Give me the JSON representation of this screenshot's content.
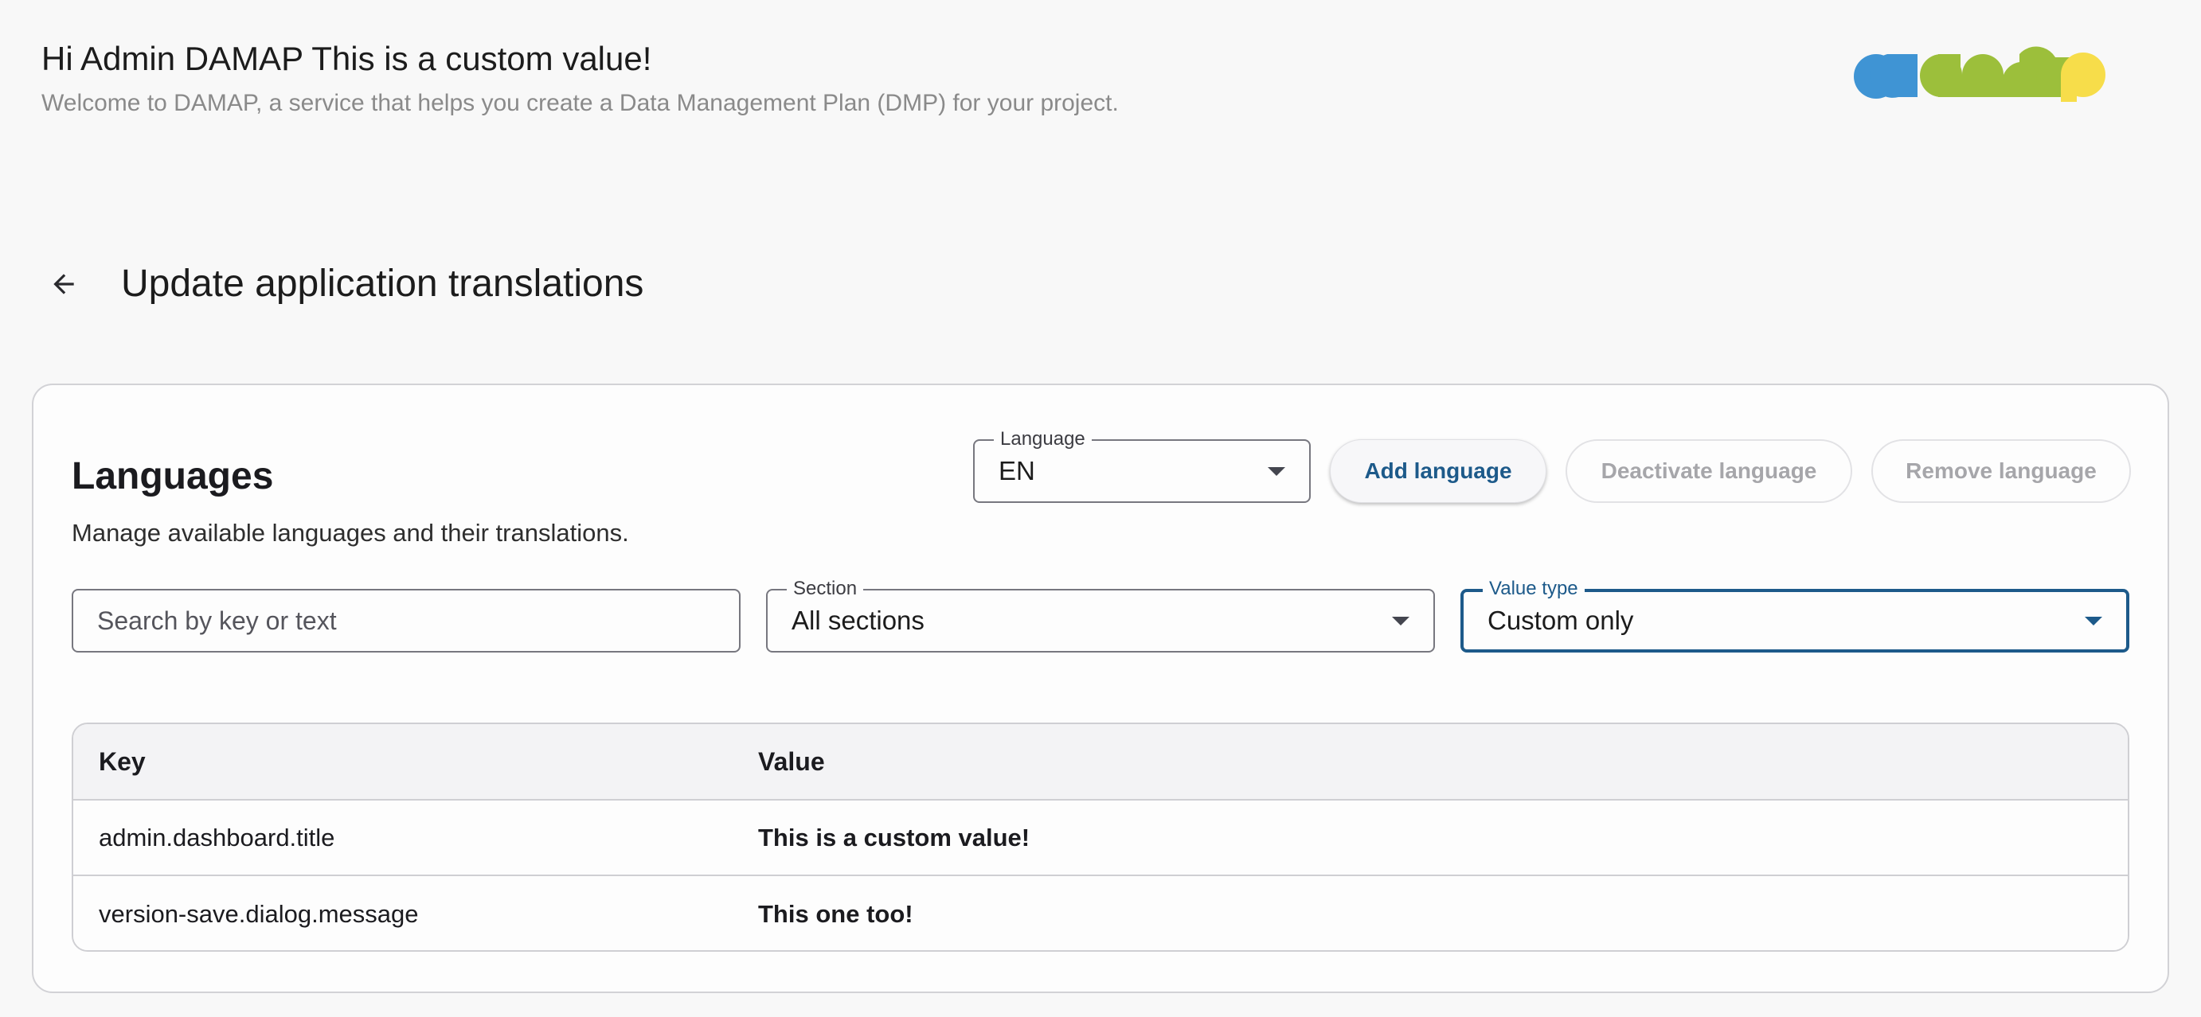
{
  "header": {
    "greeting": "Hi Admin DAMAP This is a custom value!",
    "welcome": "Welcome to DAMAP, a service that helps you create a Data Management Plan (DMP) for your project.",
    "logo_text": "damap",
    "logo_colors": [
      "#3f94d4",
      "#9cbf3b",
      "#f7dd4a"
    ]
  },
  "page": {
    "title": "Update application translations"
  },
  "languages": {
    "title": "Languages",
    "subtitle": "Manage available languages and their translations.",
    "language_select": {
      "label": "Language",
      "value": "EN"
    },
    "buttons": {
      "add": "Add language",
      "deactivate": "Deactivate language",
      "remove": "Remove language"
    }
  },
  "filters": {
    "search": {
      "placeholder": "Search by key or text",
      "value": ""
    },
    "section": {
      "label": "Section",
      "value": "All sections"
    },
    "value_type": {
      "label": "Value type",
      "value": "Custom only"
    }
  },
  "table": {
    "columns": [
      "Key",
      "Value"
    ],
    "rows": [
      {
        "key": "admin.dashboard.title",
        "value": "This is a custom value!"
      },
      {
        "key": "version-save.dialog.message",
        "value": "This one too!"
      }
    ]
  },
  "colors": {
    "accent": "#1d5a8a",
    "background": "#f8f8f8"
  }
}
